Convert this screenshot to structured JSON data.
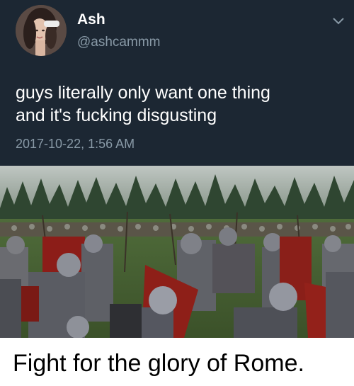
{
  "tweet": {
    "display_name": "Ash",
    "handle": "@ashcammm",
    "text_lines": [
      "guys literally only want one thing",
      "and it's fucking disgusting"
    ],
    "timestamp": "2017-10-22, 1:56 AM",
    "background_color": "#1c2733",
    "secondary_text_color": "#8899a6"
  },
  "icons": {
    "menu": "chevron-down-icon",
    "avatar": "profile-photo"
  },
  "image": {
    "subject": "roman-legion-battle-painting"
  },
  "caption": {
    "text": "Fight for the glory of Rome."
  }
}
